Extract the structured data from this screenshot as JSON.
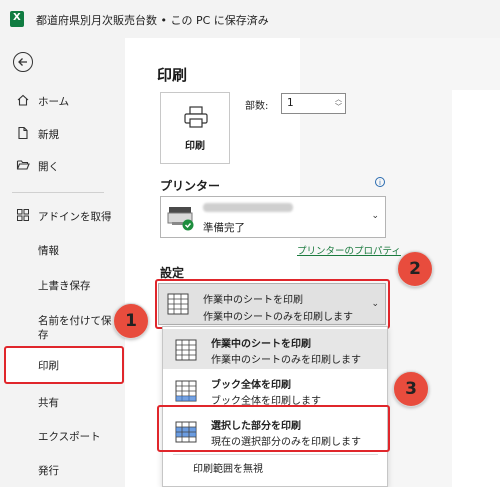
{
  "window": {
    "title": "都道府県別月次販売台数 • この PC に保存済み"
  },
  "sidebar": {
    "items": [
      {
        "label": "ホーム",
        "icon": "home-icon"
      },
      {
        "label": "新規",
        "icon": "new-document-icon"
      },
      {
        "label": "開く",
        "icon": "folder-open-icon"
      },
      {
        "label": "アドインを取得",
        "icon": "grid-addin-icon"
      },
      {
        "label": "情報"
      },
      {
        "label": "上書き保存"
      },
      {
        "label": "名前を付けて保存"
      },
      {
        "label": "印刷"
      },
      {
        "label": "共有"
      },
      {
        "label": "エクスポート"
      },
      {
        "label": "発行"
      }
    ],
    "save_as_line1": "名前を付けて保",
    "save_as_line2": "存"
  },
  "print": {
    "title": "印刷",
    "print_button": "印刷",
    "copies_label": "部数:",
    "copies_value": "1"
  },
  "printer": {
    "section_title": "プリンター",
    "status": "準備完了",
    "properties_link": "プリンターのプロパティ"
  },
  "settings": {
    "section_title": "設定",
    "selected_title": "作業中のシートを印刷",
    "selected_desc": "作業中のシートのみを印刷します",
    "options": [
      {
        "title": "作業中のシートを印刷",
        "desc": "作業中のシートのみを印刷します"
      },
      {
        "title": "ブック全体を印刷",
        "desc": "ブック全体を印刷します"
      },
      {
        "title": "選択した部分を印刷",
        "desc": "現在の選択部分のみを印刷します"
      }
    ],
    "ignore_print_area": "印刷範囲を無視"
  },
  "badges": {
    "one": "1",
    "two": "2",
    "three": "3"
  },
  "colors": {
    "accent_red": "#e0262b",
    "badge_fill": "#e84c3d",
    "excel_green": "#107c41",
    "link_green": "#1a7a3e"
  }
}
